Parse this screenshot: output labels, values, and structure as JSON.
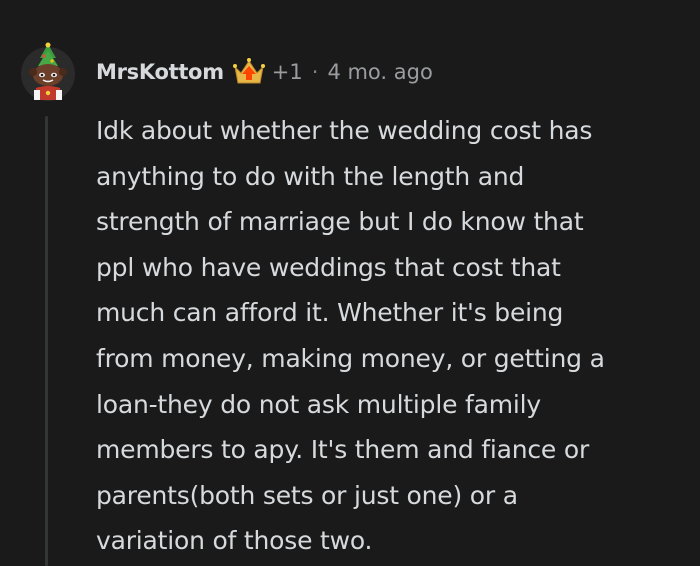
{
  "comment": {
    "username": "MrsKottom",
    "award_count": "+1",
    "separator": "·",
    "time": "4 mo. ago",
    "avatar_icon": "festive-snoo-avatar-icon",
    "award_icon": "crowned-upvote-award-icon",
    "body": "Idk about whether the wedding cost has\nanything to do with the length and\nstrength of marriage but I do know that\nppl who have weddings that cost that\nmuch can afford it. Whether it's being\nfrom money, making money, or getting a\nloan-they do not ask multiple family\nmembers to apy. It's them and fiance or\nparents(both sets or just one) or a\nvariation of those two."
  },
  "colors": {
    "background": "#1a1a1b",
    "text": "#d7dadc",
    "meta_text": "#9a9c9f",
    "thread_line": "#343536",
    "award_orange": "#ff4500",
    "award_gold": "#e8b746"
  }
}
